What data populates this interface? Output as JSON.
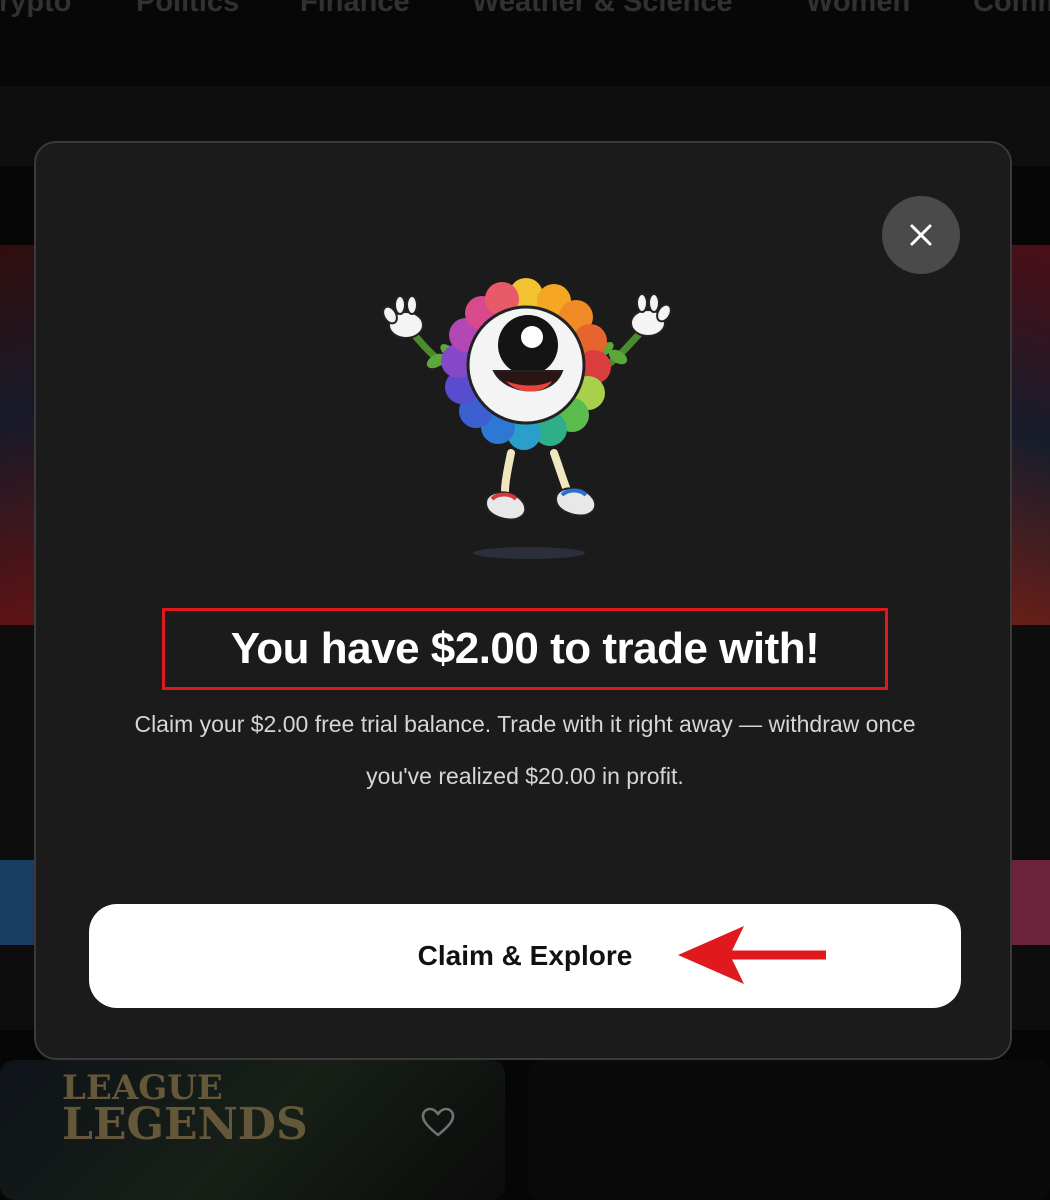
{
  "nav": {
    "items": [
      "Crypto",
      "Politics",
      "Finance",
      "Weather & Science",
      "Women",
      "Comm"
    ]
  },
  "background": {
    "bottom_card_logo_line1": "LEAGUE",
    "bottom_card_logo_line2": "LEGENDS"
  },
  "modal": {
    "headline": "You have $2.00 to trade with!",
    "description": "Claim your $2.00 free trial balance. Trade with it right away — withdraw once you've realized $20.00 in profit.",
    "cta_label": "Claim & Explore",
    "close_icon": "close-icon",
    "illustration": "rainbow-flower-mascot"
  },
  "colors": {
    "annotation_red": "#e0191f",
    "modal_bg": "#1b1b1b",
    "cta_bg": "#ffffff"
  }
}
